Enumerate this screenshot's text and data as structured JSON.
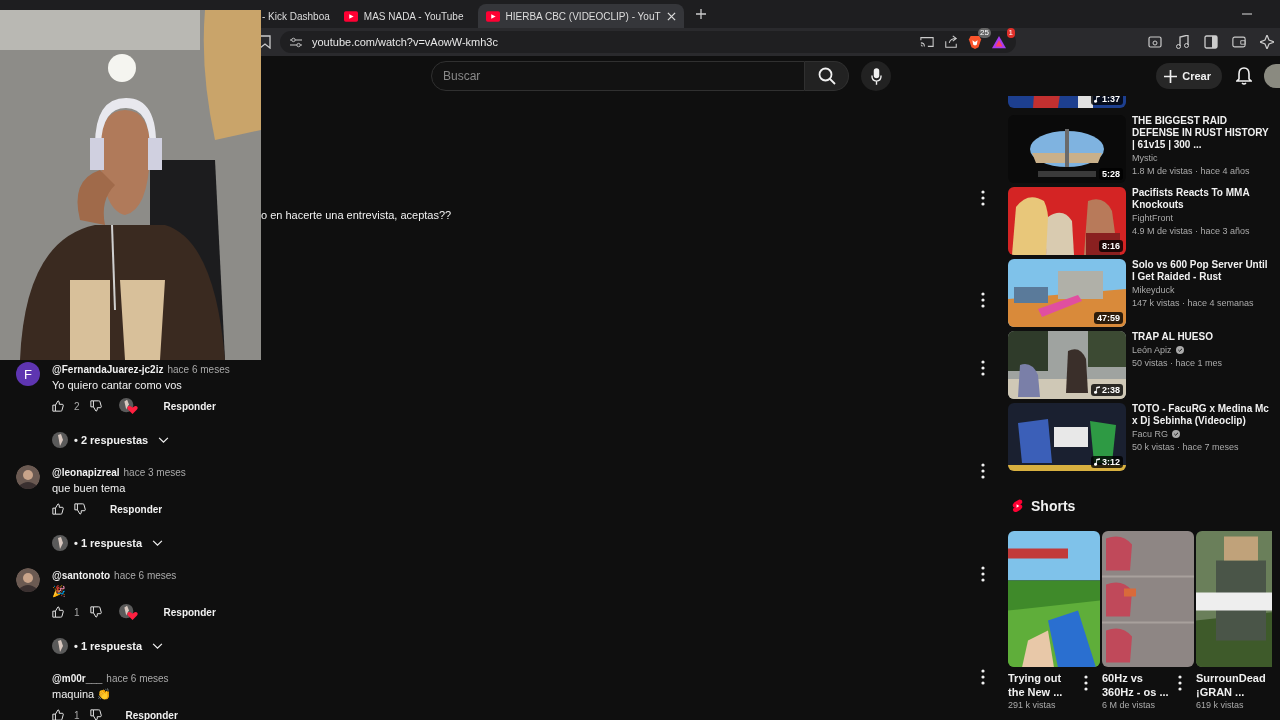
{
  "browser": {
    "tabs": [
      {
        "kind": "partial",
        "title": "- Kick Dashboa",
        "selected": false
      },
      {
        "kind": "full",
        "title": "MAS NADA - YouTube",
        "selected": false
      },
      {
        "kind": "full",
        "title": "HIERBA CBC (VIDEOCLIP) - YouT",
        "selected": true
      }
    ],
    "url": "youtube.com/watch?v=vAowW-kmh3c",
    "extension_badges": [
      "25",
      "1"
    ]
  },
  "header": {
    "search": {
      "placeholder": "Buscar"
    },
    "create_label": "Crear"
  },
  "comments": [
    {
      "kind": "partial",
      "text": "o en hacerte una entrevista, aceptas??"
    },
    {
      "kind": "covered"
    },
    {
      "kind": "full",
      "avatar": {
        "kind": "letter",
        "letter": "F"
      },
      "author": "@FernandaJuarez-jc2iz",
      "time": "hace 6 meses",
      "text": "Yo quiero cantar como vos",
      "likes": "2",
      "hearted": true,
      "reply_label": "Responder",
      "replies": "• 2 respuestas"
    },
    {
      "kind": "full",
      "author": "@leonapizreal",
      "time": "hace 3 meses",
      "text": "que buen tema",
      "hearted": false,
      "reply_label": "Responder",
      "replies": "• 1 respuesta"
    },
    {
      "kind": "full",
      "author": "@santonoto",
      "time": "hace 6 meses",
      "text": "🎉",
      "likes": "1",
      "hearted": true,
      "reply_label": "Responder",
      "replies": "• 1 respuesta"
    },
    {
      "kind": "full",
      "avatar": {
        "kind": "none"
      },
      "author": "@m00r___",
      "time": "hace 6 meses",
      "text": "maquina 👏",
      "likes": "1",
      "hearted": false,
      "reply_label": "Responder"
    }
  ],
  "related": [
    {
      "kind": "partial",
      "duration": "1:37",
      "music": true
    },
    {
      "kind": "full",
      "title": "THE BIGGEST RAID DEFENSE IN RUST HISTORY | 61v15 | 300 ...",
      "channel": "Mystic",
      "verified": false,
      "stats": "1.8 M de vistas · hace 4 años",
      "duration": "5:28",
      "music": false
    },
    {
      "kind": "full",
      "title": "Pacifists Reacts To MMA Knockouts",
      "channel": "FightFront",
      "verified": false,
      "stats": "4.9 M de vistas · hace 3 años",
      "duration": "8:16",
      "music": false
    },
    {
      "kind": "full",
      "title": "Solo vs 600 Pop Server Until I Get Raided - Rust",
      "channel": "Mikeyduck",
      "verified": false,
      "stats": "147 k vistas · hace 4 semanas",
      "duration": "47:59",
      "music": false
    },
    {
      "kind": "full",
      "title": "TRAP AL HUESO",
      "channel": "León Apiz",
      "verified": true,
      "stats": "50 vistas · hace 1 mes",
      "duration": "2:38",
      "music": true
    },
    {
      "kind": "full",
      "title": "TOTO - FacuRG x Medina Mc x Dj Sebinha (Videoclip)",
      "channel": "Facu RG",
      "verified": true,
      "stats": "50 k vistas · hace 7 meses",
      "duration": "3:12",
      "music": true
    }
  ],
  "shorts": {
    "title": "Shorts",
    "items": [
      {
        "title": "Trying out the New ...",
        "views": "291 k vistas"
      },
      {
        "title": "60Hz vs 360Hz - os ...",
        "views": "6 M de vistas"
      },
      {
        "title": "SurrounDead ¡GRAN ...",
        "views": "619 k vistas"
      }
    ]
  }
}
